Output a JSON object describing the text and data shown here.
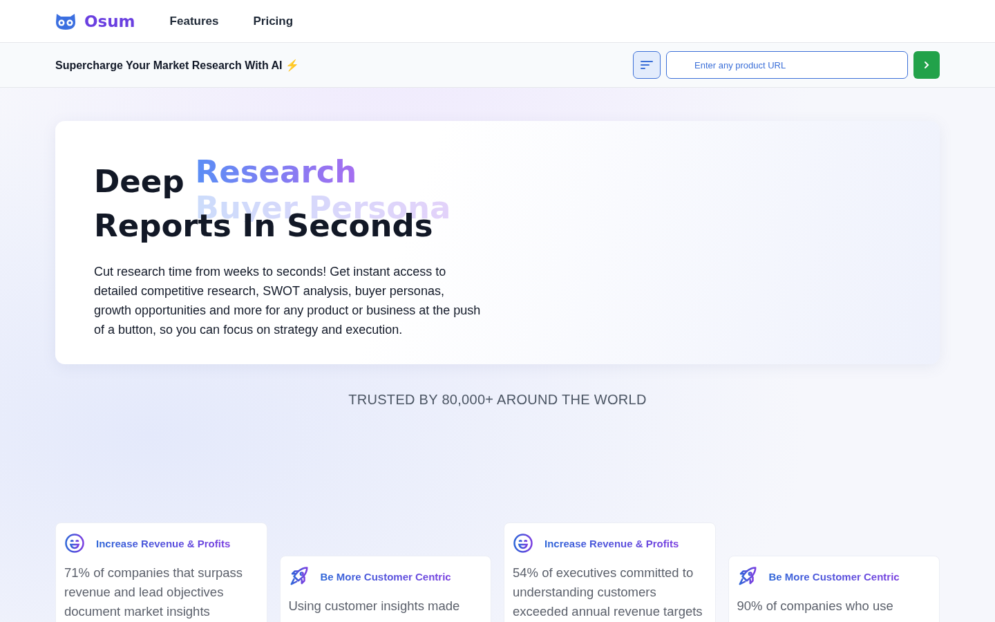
{
  "nav": {
    "brand": "Osum",
    "links": [
      {
        "label": "Features"
      },
      {
        "label": "Pricing"
      }
    ]
  },
  "subbar": {
    "tagline": "Supercharge Your Market Research With AI",
    "emoji": "⚡",
    "search": {
      "placeholder": "Enter any product URL"
    }
  },
  "hero": {
    "heading_start": "Deep",
    "rotating_words": [
      {
        "label": "Research",
        "selected": true
      },
      {
        "label": "Buyer Persona",
        "selected": false
      }
    ],
    "heading_end": "Reports In Seconds",
    "description": "Cut research time from weeks to seconds! Get instant access to detailed competitive research, SWOT analysis, buyer personas, growth opportunities and more for any product or business at the push of a button, so you can focus on strategy and execution."
  },
  "trusted": "TRUSTED BY 80,000+ AROUND THE WORLD",
  "cards": [
    {
      "kind": "smile",
      "title": "Increase Revenue & Profits",
      "text": "71% of companies that surpass revenue and lead objectives document market insights"
    },
    {
      "kind": "rocket",
      "title": "Be More Customer Centric",
      "text": "Using customer insights made"
    },
    {
      "kind": "smile",
      "title": "Increase Revenue & Profits",
      "text": "54% of executives committed to understanding customers exceeded annual revenue targets"
    },
    {
      "kind": "rocket",
      "title": "Be More Customer Centric",
      "text": "90% of companies who use"
    }
  ]
}
